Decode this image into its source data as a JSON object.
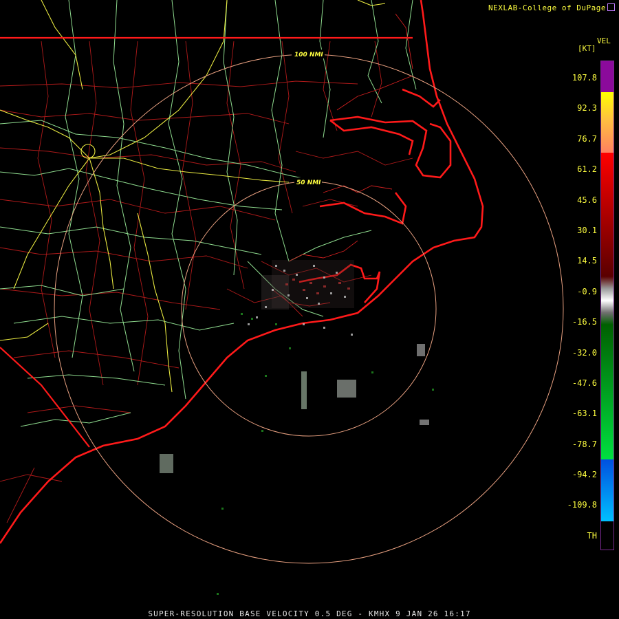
{
  "header": {
    "credit": "NEXLAB-College of DuPage"
  },
  "legend": {
    "title": "VEL",
    "unit": "[KT]",
    "labels": [
      "107.8",
      "92.3",
      "76.7",
      "61.2",
      "45.6",
      "30.1",
      "14.5",
      "-0.9",
      "-16.5",
      "-32.0",
      "-47.6",
      "-63.1",
      "-78.7",
      "-94.2",
      "-109.8",
      "TH"
    ],
    "colors": {
      "purple": "#8b0a9b",
      "yellow": "#ffff00",
      "orange": "#ffa050",
      "red": "#ff0000",
      "darkred": "#5a0000",
      "gray": "#9a9a9a",
      "darkgreen": "#006000",
      "green": "#00e040",
      "blue": "#0060ff",
      "cyan": "#00c0ff"
    }
  },
  "map": {
    "range_rings": [
      "100 NMI",
      "50 NMI"
    ],
    "colors": {
      "state_border": "#ff2020",
      "county": "#c81e1e",
      "highway": "#90e090",
      "interstate": "#e8e840",
      "ring": "#e8a080",
      "echo": "#a0a0a0"
    }
  },
  "footer": {
    "product": "SUPER-RESOLUTION BASE VELOCITY 0.5 DEG - KMHX 9 JAN 26 16:17"
  }
}
